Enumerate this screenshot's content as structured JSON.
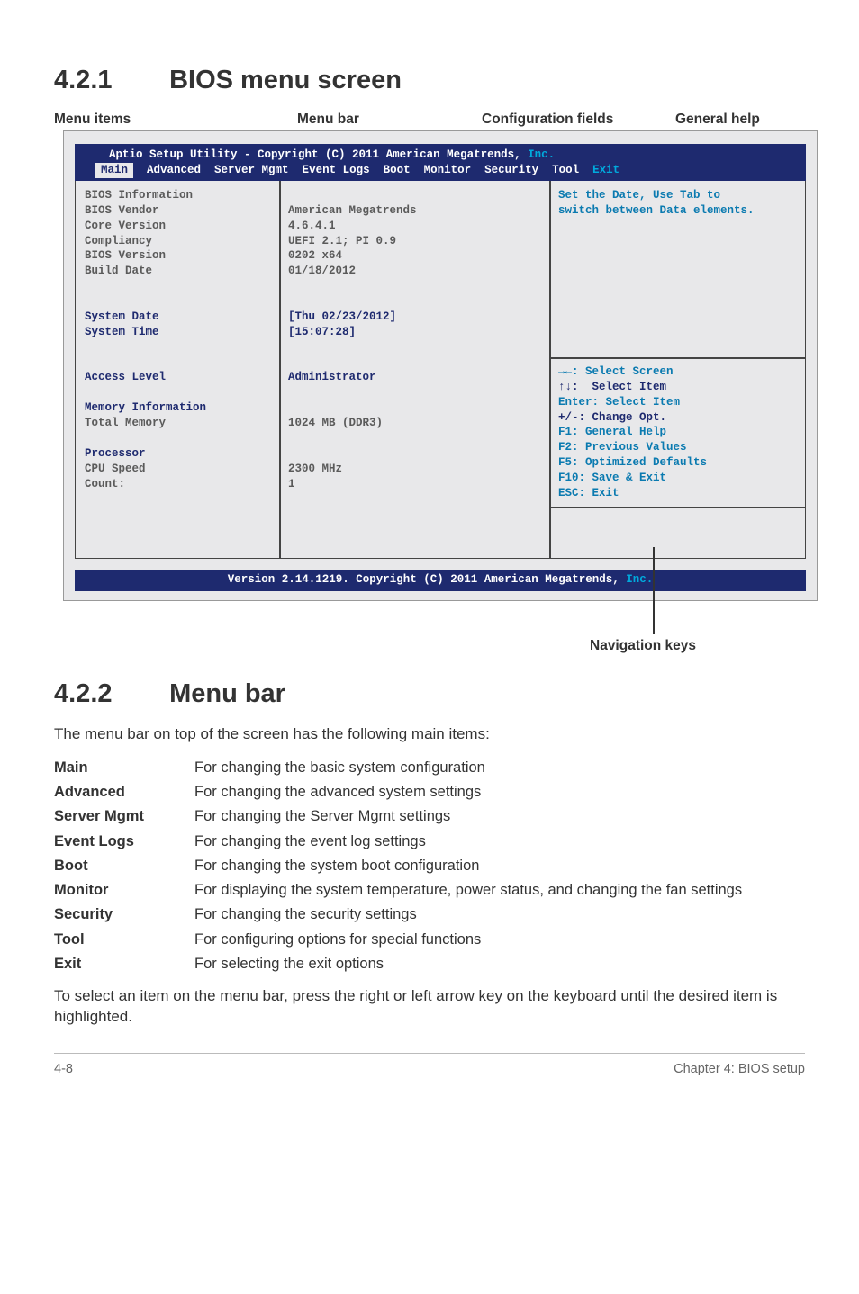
{
  "section421": {
    "num": "4.2.1",
    "title": "BIOS menu screen"
  },
  "labels": {
    "menu_items": "Menu items",
    "menu_bar": "Menu bar",
    "config_fields": "Configuration fields",
    "general_help": "General help",
    "navigation_keys": "Navigation keys"
  },
  "bios": {
    "header_copyright": "Aptio Setup Utility - Copyright (C) 2011 American Megatrends, ",
    "header_inc": "Inc.",
    "tabs": {
      "main": "Main"
    },
    "tabs_rest": "  Advanced  Server Mgmt  Event Logs  Boot  Monitor  Security  Tool  ",
    "tabs_exit": "Exit",
    "left": {
      "bios_information": "BIOS Information",
      "bios_vendor": "BIOS Vendor",
      "core_version": "Core Version",
      "compliancy": "Compliancy",
      "bios_version": "BIOS Version",
      "build_date": "Build Date",
      "system_date": "System Date",
      "system_time": "System Time",
      "access_level": "Access Level",
      "memory_information": "Memory Information",
      "total_memory": "Total Memory",
      "processor": "Processor",
      "cpu_speed": "CPU Speed",
      "count": "Count:"
    },
    "mid": {
      "vendor": "American Megatrends",
      "core": "4.6.4.1",
      "compliancy": "UEFI 2.1; PI 0.9",
      "version": "0202 x64",
      "build": "01/18/2012",
      "date": "[Thu 02/23/2012]",
      "time": "[15:07:28]",
      "access": "Administrator",
      "memory": "1024 MB (DDR3)",
      "cpu": "2300 MHz",
      "count": "1"
    },
    "right": {
      "help1": "Set the Date, Use Tab to",
      "help2": "switch between Data elements.",
      "k_screen": "→←: Select Screen",
      "k_item": "↑↓:  Select Item",
      "k_enter": "Enter: Select Item",
      "k_change": "+/-: Change Opt.",
      "k_f1": "F1: General Help",
      "k_f2": "F2: Previous Values",
      "k_f5": "F5: Optimized Defaults",
      "k_f10": "F10: Save & Exit",
      "k_esc": "ESC: Exit"
    },
    "footer_text": "Version 2.14.1219. Copyright (C) 2011 American Megatrends, ",
    "footer_inc": "Inc."
  },
  "section422": {
    "num": "4.2.2",
    "title": "Menu bar"
  },
  "intro422": "The menu bar on top of the screen has the following main items:",
  "defs": [
    {
      "term": "Main",
      "def": "For changing the basic system configuration"
    },
    {
      "term": "Advanced",
      "def": "For changing the advanced system settings"
    },
    {
      "term": "Server Mgmt",
      "def": "For changing the Server Mgmt settings"
    },
    {
      "term": "Event Logs",
      "def": "For changing the event log settings"
    },
    {
      "term": "Boot",
      "def": "For changing the system boot configuration"
    },
    {
      "term": "Monitor",
      "def": "For displaying the system temperature, power status, and changing the fan settings"
    },
    {
      "term": "Security",
      "def": "For changing the security settings"
    },
    {
      "term": "Tool",
      "def": "For configuring options for special functions"
    },
    {
      "term": "Exit",
      "def": "For selecting the exit options"
    }
  ],
  "closing422": "To select an item on the menu bar, press the right or left arrow key on the keyboard until the desired item is highlighted.",
  "footer": {
    "left": "4-8",
    "right": "Chapter 4: BIOS setup"
  }
}
